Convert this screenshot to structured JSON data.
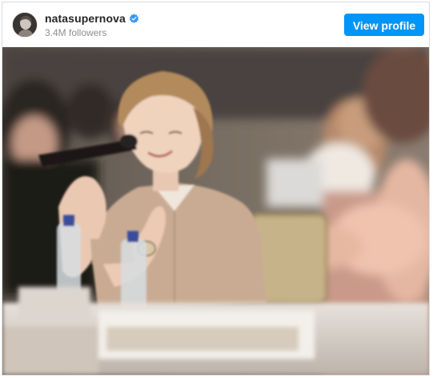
{
  "header": {
    "username": "natasupernova",
    "followers": "3.4M followers",
    "view_profile_label": "View profile"
  },
  "icons": {
    "verified": "verified-badge-icon",
    "avatar": "profile-avatar"
  },
  "colors": {
    "button_blue": "#0095f6",
    "verified_blue": "#3897f0",
    "username_text": "#262626",
    "secondary_text": "#8e8e8e"
  }
}
